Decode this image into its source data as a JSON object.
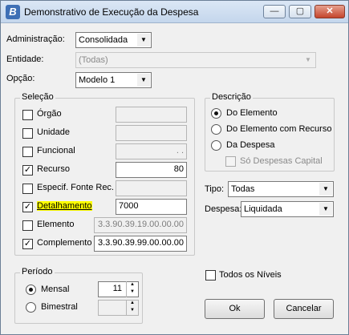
{
  "window": {
    "title": "Demonstrativo de Execução da Despesa",
    "icon_letter": "B",
    "minimize": "—",
    "maximize": "▢",
    "close": "✕"
  },
  "top": {
    "administracao_label": "Administração:",
    "administracao_value": "Consolidada",
    "entidade_label": "Entidade:",
    "entidade_value": "(Todas)",
    "opcao_label": "Opção:",
    "opcao_value": "Modelo 1"
  },
  "selecao": {
    "title": "Seleção",
    "rows": [
      {
        "label": "Órgão",
        "checked": false,
        "value": ""
      },
      {
        "label": "Unidade",
        "checked": false,
        "value": ""
      },
      {
        "label": "Funcional",
        "checked": false,
        "value": ". ."
      },
      {
        "label": "Recurso",
        "checked": true,
        "value": "80"
      },
      {
        "label": "Especif. Fonte Rec.",
        "checked": false,
        "value": ""
      },
      {
        "label": "Detalhamento",
        "checked": true,
        "value": "7000"
      },
      {
        "label": "Elemento",
        "checked": false,
        "value": "3.3.90.39.19.00.00.00"
      },
      {
        "label": "Complemento",
        "checked": true,
        "value": "3.3.90.39.99.00.00.00"
      }
    ]
  },
  "descricao": {
    "title": "Descrição",
    "options": [
      "Do Elemento",
      "Do Elemento com Recurso",
      "Da Despesa"
    ],
    "selected_index": 0,
    "so_despesas_capital": "Só Despesas Capital"
  },
  "tipo": {
    "label": "Tipo:",
    "value": "Todas"
  },
  "despesa": {
    "label": "Despesa:",
    "value": "Liquidada"
  },
  "periodo": {
    "title": "Período",
    "mensal_label": "Mensal",
    "mensal_value": "11",
    "bimestral_label": "Bimestral",
    "bimestral_value": "",
    "selected": "Mensal"
  },
  "todos_niveis": "Todos os Níveis",
  "buttons": {
    "ok": "Ok",
    "cancel": "Cancelar"
  },
  "colors": {
    "highlight": "#ffff00",
    "titlebar": "#c4d6ec",
    "close": "#c4452c"
  }
}
